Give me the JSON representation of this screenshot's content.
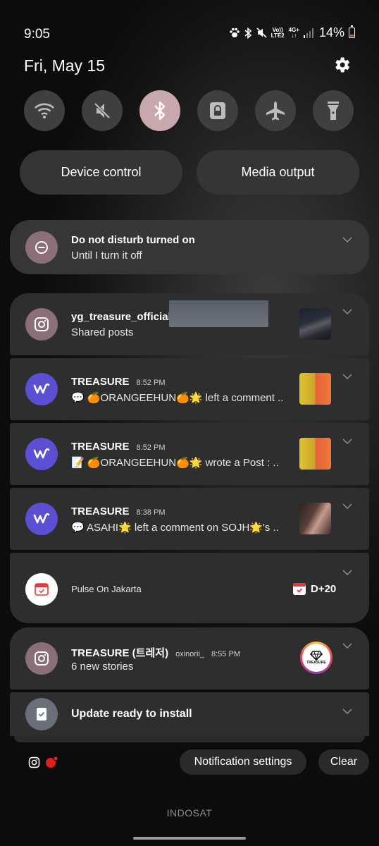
{
  "status_bar": {
    "time": "9:05",
    "network_top": "Vo))",
    "network_bottom": "LTE2",
    "data_top": "4G+",
    "battery_percent": "14%",
    "icons": [
      "paw-icon",
      "bluetooth-icon",
      "mute-icon",
      "signal-icon",
      "battery-icon"
    ]
  },
  "header": {
    "date": "Fri, May 15"
  },
  "quick_settings": [
    {
      "name": "wifi",
      "icon": "wifi-icon",
      "active": false
    },
    {
      "name": "sound",
      "icon": "mute-icon",
      "active": false
    },
    {
      "name": "bluetooth",
      "icon": "bluetooth-icon",
      "active": true
    },
    {
      "name": "screen-lock",
      "icon": "lock-icon",
      "active": false
    },
    {
      "name": "airplane",
      "icon": "airplane-icon",
      "active": false
    },
    {
      "name": "flashlight",
      "icon": "flashlight-icon",
      "active": false
    }
  ],
  "pills": {
    "device_control": "Device control",
    "media_output": "Media output"
  },
  "notifications": {
    "dnd": {
      "title": "Do not disturb turned on",
      "text": "Until I turn it off"
    },
    "insta1": {
      "title": "yg_treasure_official",
      "text": "Shared posts"
    },
    "weverse1": {
      "title": "TREASURE",
      "time": "8:52 PM",
      "text": "💬 🍊ORANGEEHUN🍊🌟 left a comment .."
    },
    "weverse2": {
      "title": "TREASURE",
      "time": "8:52 PM",
      "text": "📝 🍊ORANGEEHUN🍊🌟 wrote a Post : .."
    },
    "weverse3": {
      "title": "TREASURE",
      "time": "8:38 PM",
      "text": "💬 ASAHI🌟 left a comment on SOJH🌟's .."
    },
    "pulse": {
      "text": "Pulse On Jakarta",
      "badge": "D+20"
    },
    "insta2": {
      "title": "TREASURE (트레저)",
      "sub": "oxinorii_",
      "time": "8:55 PM",
      "text": "6 new stories",
      "logo_text": "TREASURE"
    },
    "update": {
      "title": "Update ready to install"
    }
  },
  "footer": {
    "notification_settings": "Notification settings",
    "clear": "Clear",
    "carrier": "INDOSAT"
  },
  "colors": {
    "accent_toggle": "#c9a8ad",
    "weverse": "#5b4fd3",
    "insta_icon_bg": "#8a6f76"
  }
}
